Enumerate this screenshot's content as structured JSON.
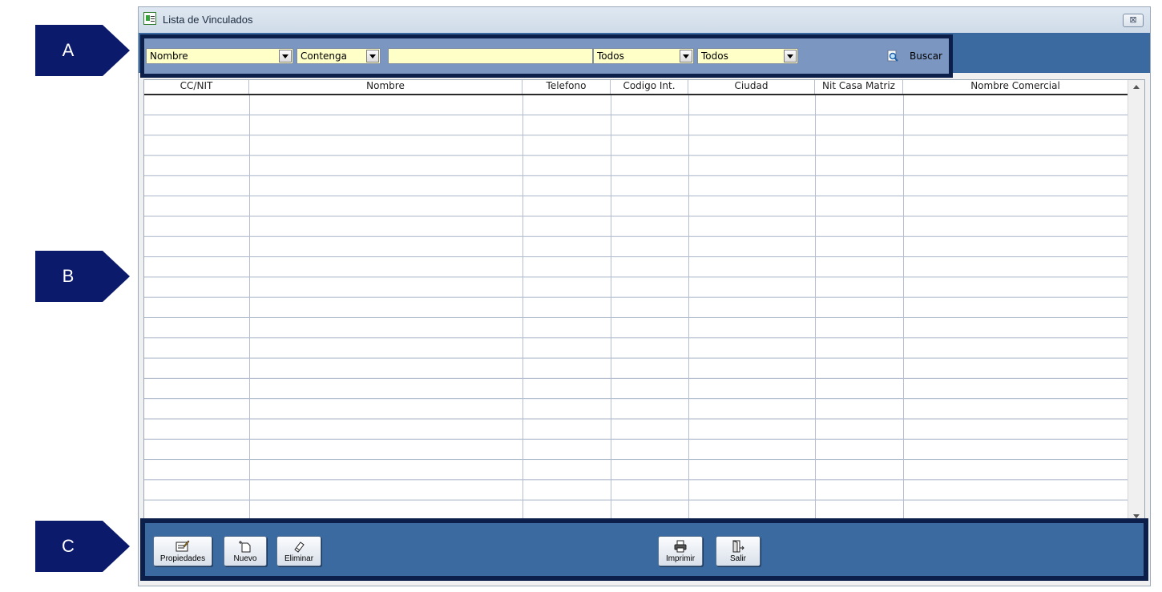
{
  "callouts": [
    "A",
    "B",
    "C"
  ],
  "window": {
    "title": "Lista de Vinculados",
    "close_symbol": "⊠"
  },
  "filters": {
    "field": "Nombre",
    "operator": "Contenga",
    "search_value": "",
    "filter1": "Todos",
    "filter2": "Todos",
    "search_button": "Buscar"
  },
  "grid": {
    "columns": [
      "CC/NIT",
      "Nombre",
      "Telefono",
      "Codigo Int.",
      "Ciudad",
      "Nit Casa Matriz",
      "Nombre Comercial"
    ],
    "rows": []
  },
  "actions": {
    "properties": "Propiedades",
    "new": "Nuevo",
    "delete": "Eliminar",
    "print": "Imprimir",
    "exit": "Salir"
  },
  "colors": {
    "toolbar_bg": "#3a6aa0",
    "frame": "#0c1f4a",
    "input_bg": "#ffffc8"
  }
}
